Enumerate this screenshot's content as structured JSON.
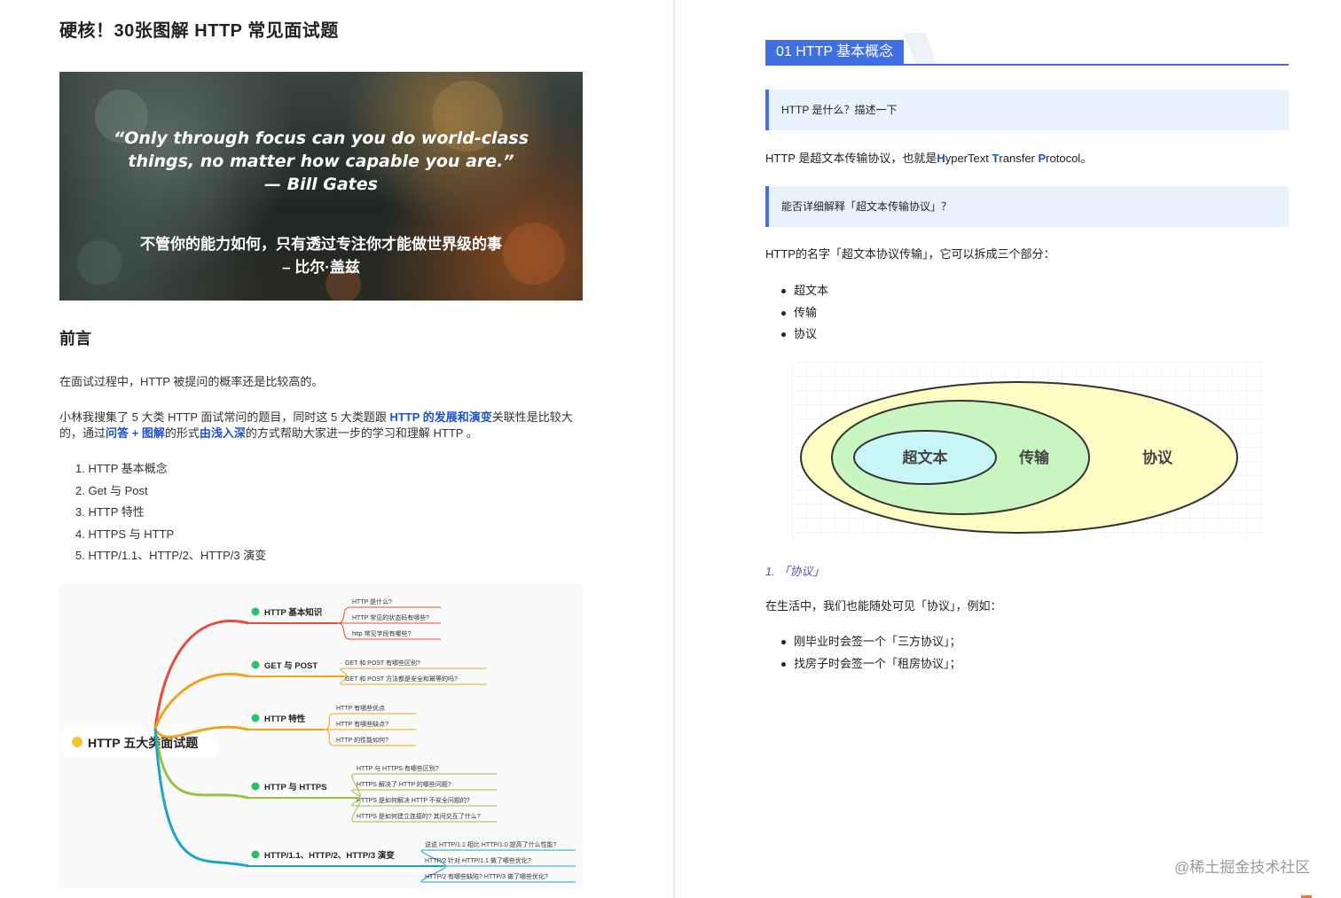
{
  "article": {
    "title": "硬核！30张图解 HTTP 常见面试题"
  },
  "hero": {
    "quote_en_line1": "“Only through focus can you do world-class",
    "quote_en_line2": "things, no matter how capable you are.”",
    "quote_en_line3": "— Bill Gates",
    "quote_cn_line1": "不管你的能力如何，只有透过专注你才能做世界级的事",
    "quote_cn_line2": "– 比尔·盖兹"
  },
  "preface": {
    "heading": "前言",
    "para1": "在面试过程中，HTTP 被提问的概率还是比较高的。",
    "para2_a": "小林我搜集了 5 大类 HTTP 面试常问的题目，同时这 5 大类题跟 ",
    "para2_b": "HTTP 的发展和演变",
    "para2_c": "关联性是比较大的，通过",
    "para2_d": "问答 + 图解",
    "para2_e": "的形式",
    "para2_f": "由浅入深",
    "para2_g": "的方式帮助大家进一步的学习和理解 HTTP 。",
    "toc": [
      "1. HTTP 基本概念",
      "2. Get 与 Post",
      "3. HTTP 特性",
      "4. HTTPS 与 HTTP",
      "5. HTTP/1.1、HTTP/2、HTTP/3 演变"
    ]
  },
  "mindmap": {
    "root": "HTTP 五大类面试题",
    "branches": [
      {
        "label": "HTTP 基本知识",
        "color": "#e84a3c",
        "leaves": [
          "HTTP 是什么?",
          "HTTP 常见的状态码有哪些?",
          "http 常见字段有哪些?"
        ]
      },
      {
        "label": "GET 与 POST",
        "color": "#f4a21e",
        "leaves": [
          "GET 和 POST 有哪些区别?",
          "GET 和 POST 方法都是安全和幂等的吗?"
        ]
      },
      {
        "label": "HTTP 特性",
        "color": "#f4a21e",
        "leaves": [
          "HTTP 有哪些优点",
          "HTTP 有哪些缺点?",
          "HTTP 的性能如何?"
        ]
      },
      {
        "label": "HTTP 与 HTTPS",
        "color": "#97c23b",
        "leaves": [
          "HTTP 与 HTTPS 有哪些区别?",
          "HTTPS 解决了 HTTP 的哪些问题?",
          "HTTPS 是如何解决 HTTP 不安全问题的?",
          "HTTPS 是如何建立连接的? 其间交互了什么?"
        ]
      },
      {
        "label": "HTTP/1.1、HTTP/2、HTTP/3 演变",
        "color": "#1ba5c9",
        "leaves": [
          "说说 HTTP/1.1 相比 HTTP/1.0 提高了什么性能?",
          "HTTP/2 针对 HTTP/1.1 做了哪些优化?",
          "HTTP/2 有哪些缺陷? HTTP/3 做了哪些优化?"
        ]
      }
    ]
  },
  "right": {
    "section_tag": "01 HTTP 基本概念",
    "q1": "HTTP 是什么？描述一下",
    "a1_pre": "HTTP 是超文本传输协议，也就是",
    "a1_H": "H",
    "a1_yper": "yperText ",
    "a1_T": "T",
    "a1_ransfer": "ransfer ",
    "a1_P": "P",
    "a1_rotocol": "rotocol。",
    "q2": "能否详细解释「超文本传输协议」？",
    "a2": "HTTP的名字「超文本协议传输」，它可以拆成三个部分：",
    "parts": [
      "超文本",
      "传输",
      "协议"
    ],
    "diagram": {
      "inner": "超文本",
      "middle": "传输",
      "outer": "协议",
      "inner_color": "#c8f6f7",
      "middle_color": "#c9f5c2",
      "outer_color": "#fdfdc4"
    },
    "numbered_item": "1. 「协议」",
    "a3": "在生活中，我们也能随处可见「协议」，例如：",
    "examples": [
      "刚毕业时会签一个「三方协议」；",
      "找房子时会签一个「租房协议」；"
    ],
    "watermark": "@稀土掘金技术社区"
  }
}
